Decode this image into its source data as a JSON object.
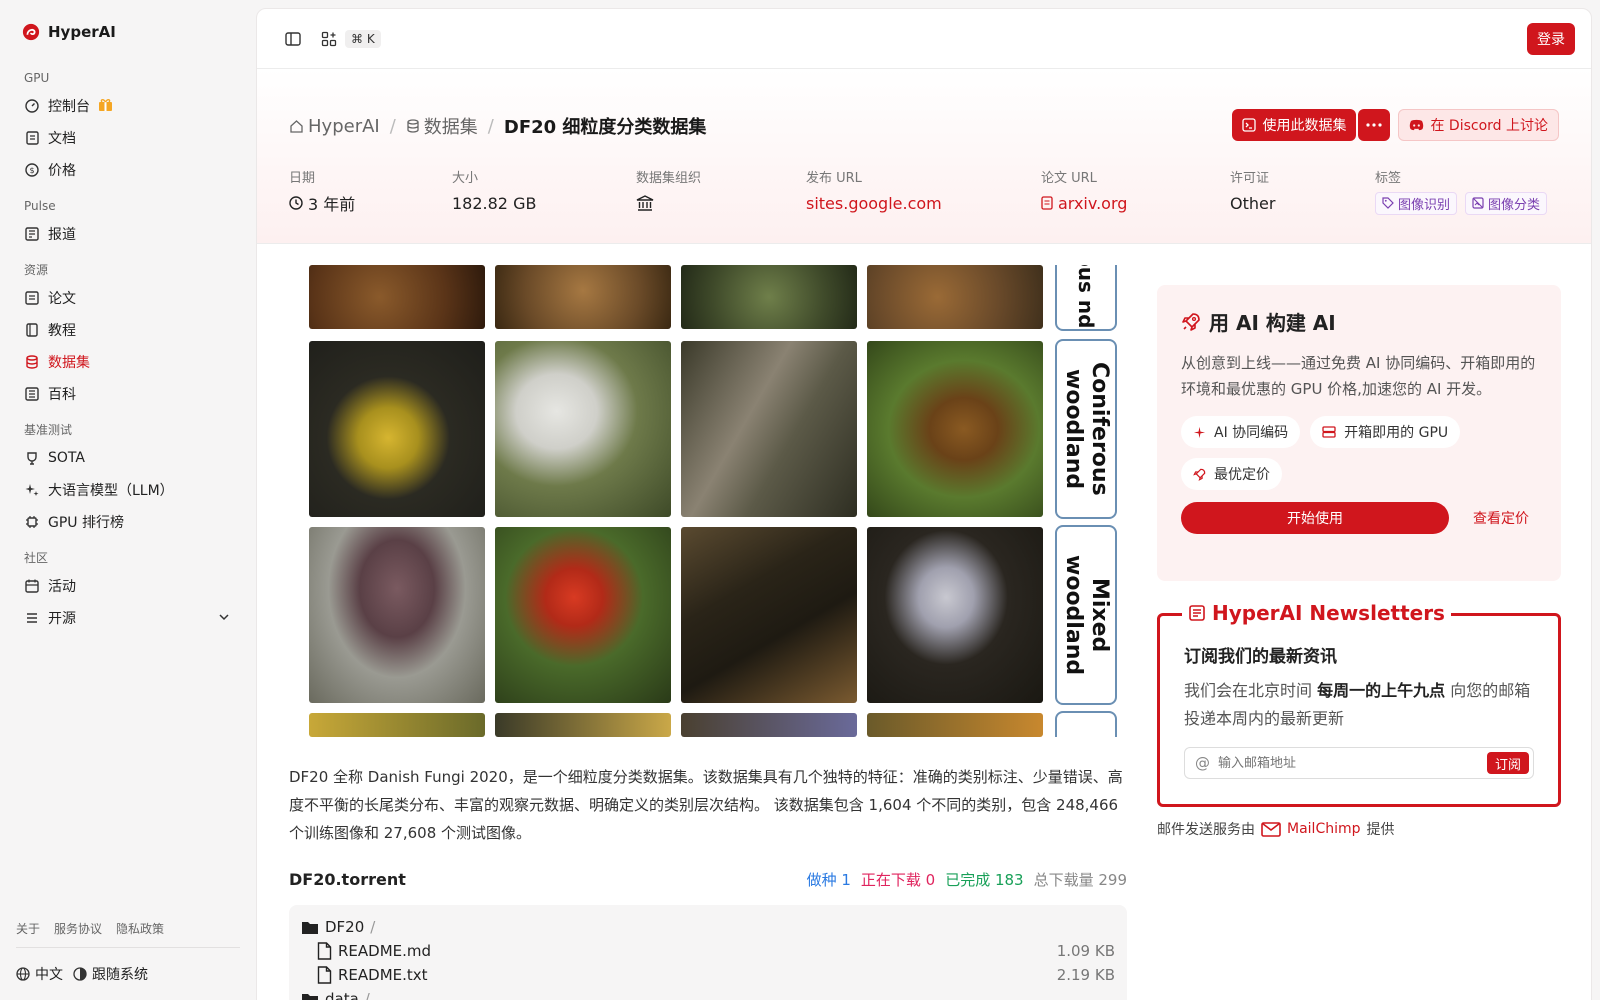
{
  "brand": {
    "name": "HyperAI"
  },
  "sidebar": {
    "groups": [
      {
        "title": "GPU",
        "items": [
          {
            "label": "控制台"
          },
          {
            "label": "文档"
          },
          {
            "label": "价格"
          }
        ]
      },
      {
        "title": "Pulse",
        "items": [
          {
            "label": "报道"
          }
        ]
      },
      {
        "title": "资源",
        "items": [
          {
            "label": "论文"
          },
          {
            "label": "教程"
          },
          {
            "label": "数据集"
          },
          {
            "label": "百科"
          }
        ]
      },
      {
        "title": "基准测试",
        "items": [
          {
            "label": "SOTA"
          },
          {
            "label": "大语言模型（LLM）"
          },
          {
            "label": "GPU 排行榜"
          }
        ]
      },
      {
        "title": "社区",
        "items": [
          {
            "label": "活动"
          },
          {
            "label": "开源"
          }
        ]
      }
    ],
    "active_item": "数据集",
    "footer_links": [
      "关于",
      "服务协议",
      "隐私政策"
    ],
    "language": "中文",
    "theme": "跟随系统"
  },
  "topbar": {
    "shortcut": "⌘ K",
    "login_label": "登录"
  },
  "breadcrumb": {
    "home": "HyperAI",
    "section": "数据集",
    "current": "DF20 细粒度分类数据集"
  },
  "actions": {
    "use_dataset": "使用此数据集",
    "discord": "在 Discord 上讨论"
  },
  "meta": {
    "date_label": "日期",
    "date_value": "3 年前",
    "size_label": "大小",
    "size_value": "182.82 GB",
    "org_label": "数据集组织",
    "url_label": "发布 URL",
    "url_value": "sites.google.com",
    "paper_label": "论文 URL",
    "paper_value": "arxiv.org",
    "license_label": "许可证",
    "license_value": "Other",
    "tags_label": "标签",
    "tags": [
      "图像识别",
      "图像分类"
    ]
  },
  "image": {
    "row_labels": [
      "Coniferous woodland",
      "Mixed woodland"
    ],
    "top_label": "ous nd"
  },
  "description": "DF20 全称 Danish Fungi 2020，是一个细粒度分类数据集。该数据集具有几个独特的特征：准确的类别标注、少量错误、高度不平衡的长尾类分布、丰富的观察元数据、明确定义的类别层次结构。 该数据集包含 1,604 个不同的类别，包含 248,466 个训练图像和 27,608 个测试图像。",
  "torrent": {
    "title": "DF20.torrent",
    "seeding": "做种 1",
    "downloading": "正在下载 0",
    "completed": "已完成 183",
    "total": "总下载量 299",
    "files": [
      {
        "name": "DF20",
        "type": "folder",
        "size": ""
      },
      {
        "name": "README.md",
        "type": "file",
        "size": "1.09 KB"
      },
      {
        "name": "README.txt",
        "type": "file",
        "size": "2.19 KB"
      },
      {
        "name": "data",
        "type": "folder",
        "size": ""
      }
    ]
  },
  "ai_card": {
    "title": "用 AI 构建 AI",
    "description": "从创意到上线——通过免费 AI 协同编码、开箱即用的环境和最优惠的 GPU 价格,加速您的 AI 开发。",
    "chips": [
      "AI 协同编码",
      "开箱即用的 GPU",
      "最优定价"
    ],
    "start_label": "开始使用",
    "pricing_label": "查看定价"
  },
  "newsletter": {
    "legend": "HyperAI Newsletters",
    "title": "订阅我们的最新资讯",
    "desc_pre": "我们会在北京时间 ",
    "desc_bold": "每周一的上午九点",
    "desc_post": " 向您的邮箱投递本周内的最新更新",
    "placeholder": "输入邮箱地址",
    "subscribe_label": "订阅",
    "powered_pre": "邮件发送服务由",
    "powered_brand": "MailChimp",
    "powered_post": "提供"
  },
  "colors": {
    "accent": "#d0161d",
    "seeding": "#2a7ae2",
    "downloading": "#e0245e",
    "completed": "#18a058"
  }
}
